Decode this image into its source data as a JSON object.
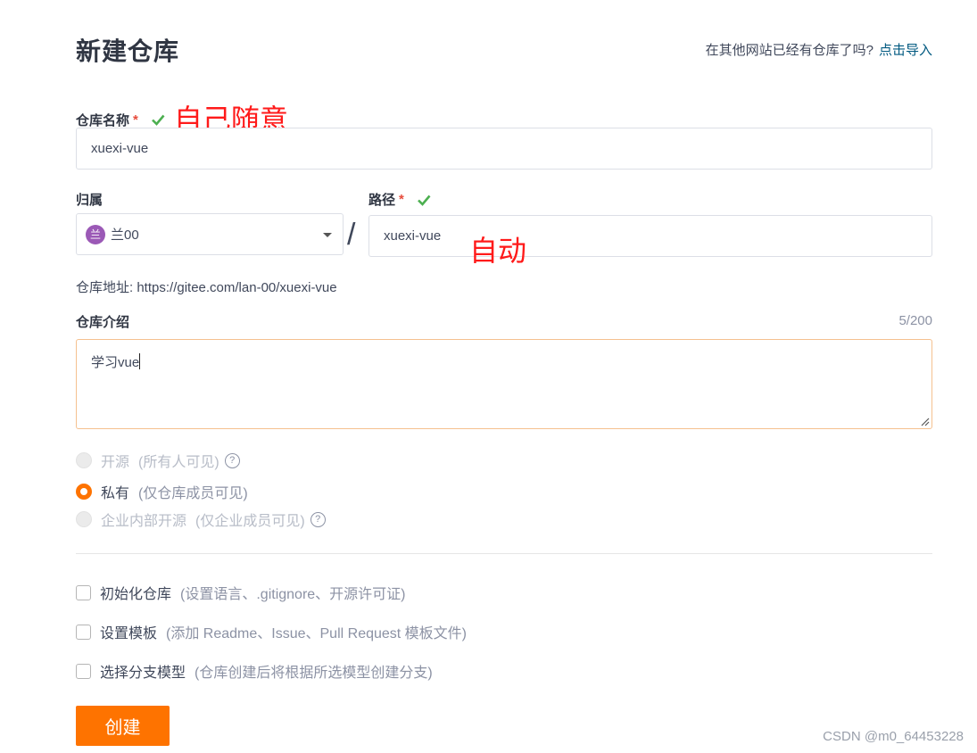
{
  "header": {
    "title": "新建仓库",
    "import_hint": "在其他网站已经有仓库了吗?",
    "import_link": "点击导入"
  },
  "repo_name": {
    "label": "仓库名称",
    "required_mark": "*",
    "annotation": "自己随意",
    "value": "xuexi-vue"
  },
  "owner": {
    "label": "归属",
    "avatar_char": "兰",
    "value": "兰00"
  },
  "path": {
    "label": "路径",
    "required_mark": "*",
    "separator": "/",
    "value": "xuexi-vue",
    "annotation": "自动"
  },
  "address": {
    "text": "仓库地址: https://gitee.com/lan-00/xuexi-vue"
  },
  "description": {
    "label": "仓库介绍",
    "counter": "5/200",
    "value": "学习vue"
  },
  "visibility": {
    "options": [
      {
        "label": "开源",
        "sub": "(所有人可见)",
        "state": "disabled",
        "help": "?"
      },
      {
        "label": "私有",
        "sub": "(仅仓库成员可见)",
        "state": "checked"
      },
      {
        "label": "企业内部开源",
        "sub": "(仅企业成员可见)",
        "state": "disabled",
        "help": "?"
      }
    ]
  },
  "options": {
    "items": [
      {
        "label": "初始化仓库",
        "sub": "(设置语言、.gitignore、开源许可证)",
        "checked": false
      },
      {
        "label": "设置模板",
        "sub": "(添加 Readme、Issue、Pull Request 模板文件)",
        "checked": false
      },
      {
        "label": "选择分支模型",
        "sub": "(仓库创建后将根据所选模型创建分支)",
        "checked": false
      }
    ]
  },
  "submit": {
    "label": "创建"
  },
  "watermark": "CSDN @m0_64453228",
  "colors": {
    "accent": "#fe7300",
    "link": "#005980",
    "check": "#4caf50",
    "annotation": "#ff1a1a"
  }
}
